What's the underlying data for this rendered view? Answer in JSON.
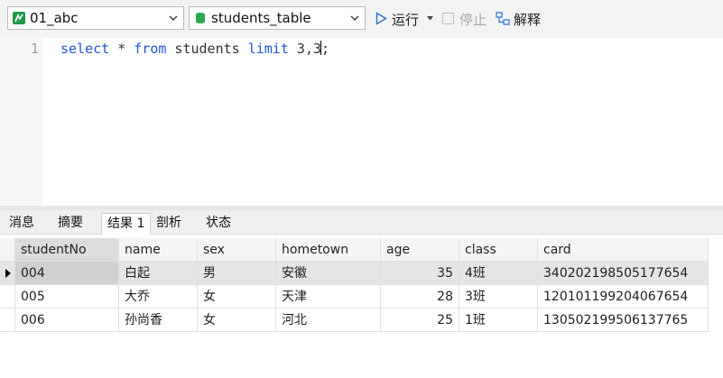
{
  "toolbar": {
    "connection": "01_abc",
    "table": "students_table",
    "run_label": "运行",
    "stop_label": "停止",
    "explain_label": "解释"
  },
  "editor": {
    "line_number": "1",
    "code": {
      "kw_select": "select",
      "star": "*",
      "kw_from": "from",
      "table": "students",
      "kw_limit": "limit",
      "n1": "3",
      "comma": ",",
      "n2": "3",
      "semicolon": ";"
    }
  },
  "tabs": [
    "消息",
    "摘要",
    "结果 1",
    "剖析",
    "状态"
  ],
  "active_tab": "结果 1",
  "result": {
    "columns": [
      "studentNo",
      "name",
      "sex",
      "hometown",
      "age",
      "class",
      "card"
    ],
    "rows": [
      [
        "004",
        "白起",
        "男",
        "安徽",
        "35",
        "4班",
        "340202198505177654"
      ],
      [
        "005",
        "大乔",
        "女",
        "天津",
        "28",
        "3班",
        "120101199204067654"
      ],
      [
        "006",
        "孙尚香",
        "女",
        "河北",
        "25",
        "1班",
        "130502199506137765"
      ]
    ],
    "selected_row": 0
  },
  "colors": {
    "keyword": "#1f55d6",
    "run_icon": "#2b6fd6",
    "table_icon": "#2aa84a",
    "connection_icon": "#1e9b4a"
  }
}
